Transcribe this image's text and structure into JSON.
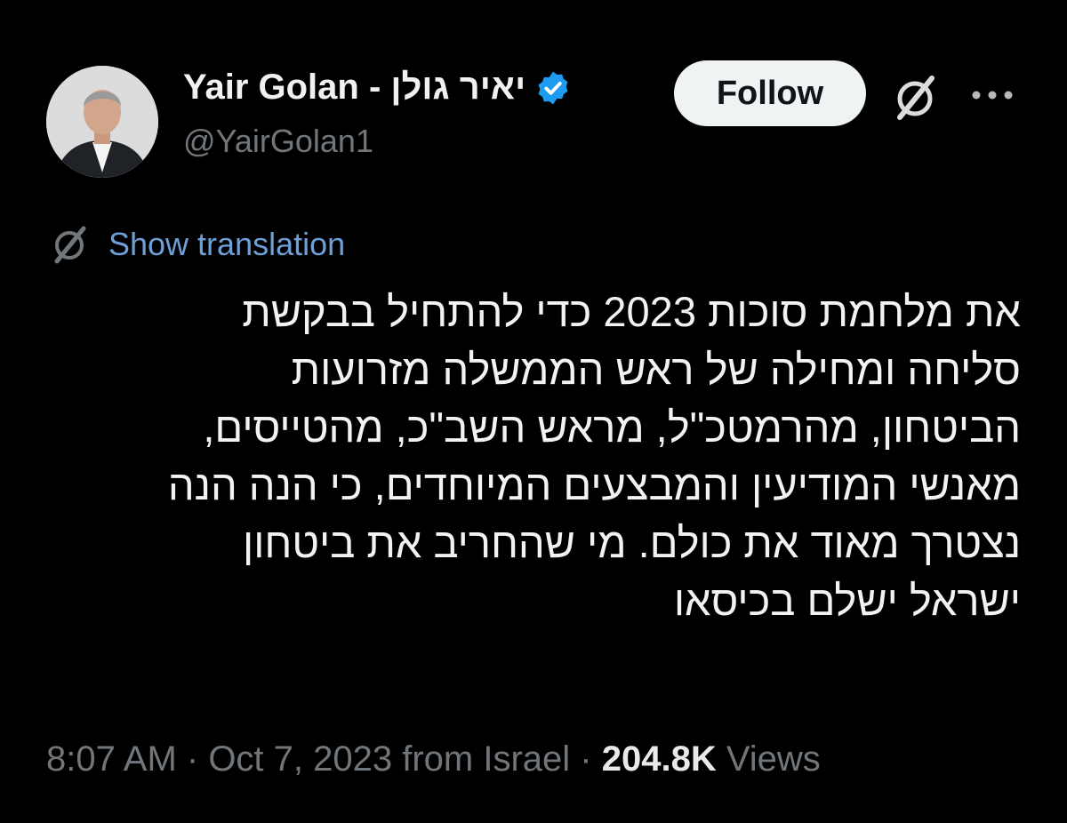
{
  "author": {
    "display_name": "Yair Golan - יאיר גולן",
    "handle": "@YairGolan1",
    "verified": true
  },
  "actions": {
    "follow_label": "Follow"
  },
  "translation": {
    "label": "Show translation"
  },
  "tweet": {
    "lines": [
      "את מלחמת סוכות 2023 כדי להתחיל בבקשת",
      "סליחה ומחילה של ראש הממשלה מזרועות",
      "הביטחון, מהרמטכ\"ל, מראש השב\"כ, מהטייסים,",
      "מאנשי המודיעין והמבצעים המיוחדים, כי הנה הנה",
      "נצטרך מאוד את כולם. מי שהחריב את ביטחון",
      "ישראל ישלם בכיסאו"
    ]
  },
  "meta": {
    "time": "8:07 AM",
    "date": "Oct 7, 2023",
    "location": "from Israel",
    "separator": " · ",
    "views_count": "204.8K",
    "views_label": "Views"
  },
  "icons": {
    "verified": "verified-badge-icon",
    "grok": "grok-icon",
    "more": "more-dots-icon"
  },
  "colors": {
    "background": "#000000",
    "text": "#e7e9ea",
    "muted": "#71767b",
    "link": "#6d9fd8",
    "verified": "#1d9bf0",
    "follow_bg": "#eff3f4"
  }
}
